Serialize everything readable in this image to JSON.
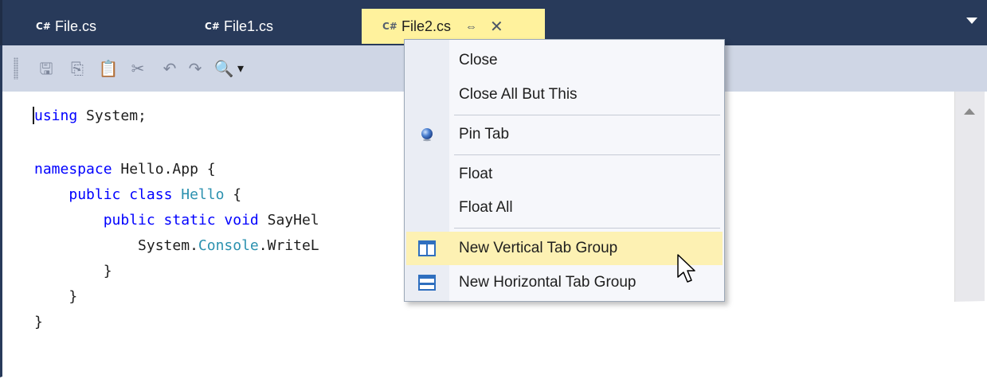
{
  "tabs": [
    {
      "label": "File.cs",
      "icon": "csharp-file-icon"
    },
    {
      "label": "File1.cs",
      "icon": "csharp-file-icon"
    },
    {
      "label": "File2.cs",
      "icon": "csharp-file-icon",
      "active": true
    }
  ],
  "icon_glyphs": {
    "csharp": "C#",
    "pin": "⇔",
    "close": "✕"
  },
  "toolbar": {
    "icons": [
      "save-icon",
      "copy-icon",
      "paste-icon",
      "cut-icon",
      "undo-icon",
      "redo-icon",
      "search-icon",
      "dropdown-icon"
    ],
    "glyphs": {
      "save": "🖫",
      "copy": "⎘",
      "paste": "📋",
      "cut": "✂",
      "undo": "↶",
      "redo": "↷",
      "search": "🔍",
      "dropdown": "▾"
    }
  },
  "code": {
    "line1_kw": "using",
    "line1_rest": " System;",
    "line3_kw": "namespace",
    "line3_rest": " Hello.App {",
    "line4_indent": "    ",
    "line4_kw": "public class",
    "line4_sp": " ",
    "line4_type": "Hello",
    "line4_rest": " {",
    "line5_indent": "        ",
    "line5_kw": "public static void",
    "line5_rest": " SayHel",
    "line6_indent": "            ",
    "line6_a": "System.",
    "line6_type": "Console",
    "line6_b": ".WriteL",
    "line7": "        }",
    "line8": "    }",
    "line9": "}"
  },
  "context_menu": {
    "items": [
      {
        "label": "Close"
      },
      {
        "label": "Close All But This"
      },
      {
        "label": "Pin Tab",
        "icon": "pin-icon"
      },
      {
        "label": "Float"
      },
      {
        "label": "Float All"
      },
      {
        "label": "New Vertical Tab Group",
        "icon": "vertical-tab-group-icon",
        "highlighted": true
      },
      {
        "label": "New Horizontal Tab Group",
        "icon": "horizontal-tab-group-icon"
      }
    ]
  },
  "colors": {
    "tabbar_bg": "#283a5a",
    "active_tab_bg": "#fff29d",
    "toolbar_bg": "#cfd6e5",
    "menu_highlight": "#fdf1b3",
    "keyword": "#0000ff",
    "type_name": "#2b91af"
  }
}
